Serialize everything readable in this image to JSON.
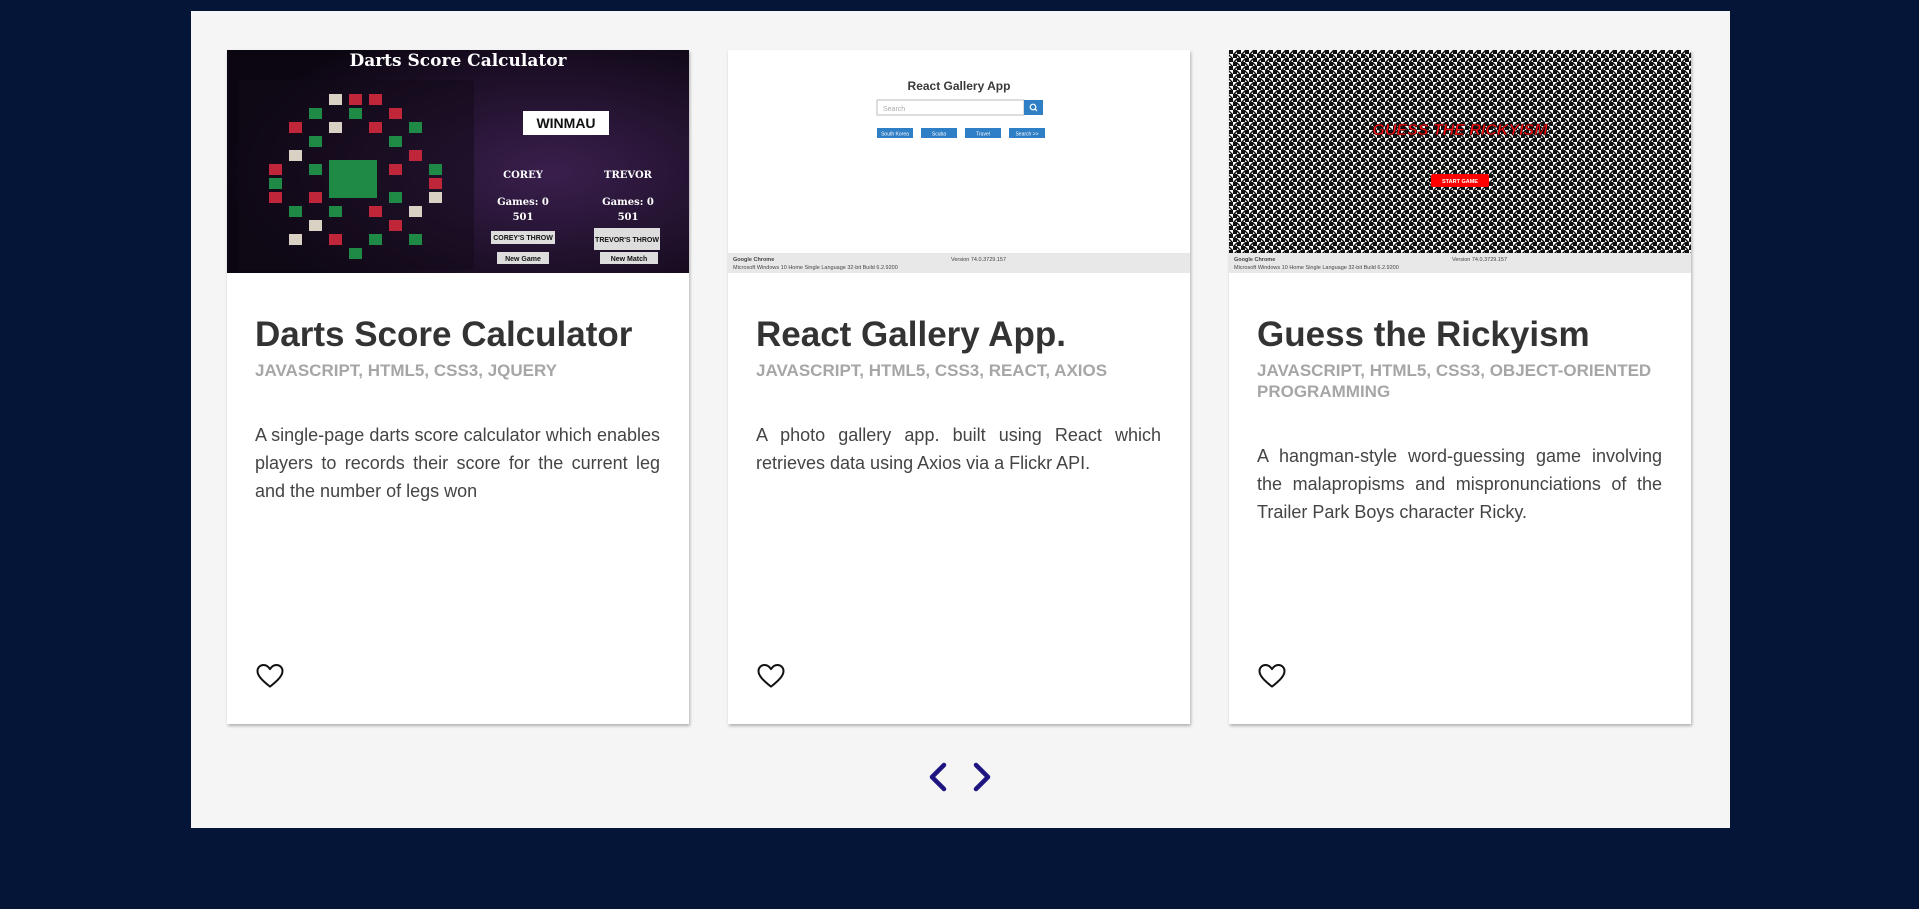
{
  "projects": [
    {
      "title": "Darts Score Calculator",
      "tags": "JAVASCRIPT, HTML5, CSS3, JQUERY",
      "description": "A single-page darts score calculator which enables players to records their score for the current leg and the number of legs won",
      "screenshot": {
        "heading": "Darts Score Calculator",
        "brand": "WINMAU",
        "player1": "COREY",
        "player2": "TREVOR",
        "games1": "Games: 0",
        "games2": "Games: 0",
        "score1": "501",
        "score2": "501",
        "throw1": "COREY'S THROW",
        "throw2": "TREVOR'S THROW",
        "new_game": "New Game",
        "new_match": "New Match"
      }
    },
    {
      "title": "React Gallery App.",
      "tags": "JAVASCRIPT, HTML5, CSS3, REACT, AXIOS",
      "description": "A photo gallery app. built using React which retrieves data using Axios via a Flickr API.",
      "screenshot": {
        "heading": "React Gallery App",
        "search_placeholder": "Search",
        "buttons": [
          "South Korea",
          "Scuba",
          "Travel",
          "Search >>"
        ],
        "footer_left": "Google Chrome",
        "footer_right": "Version 74.0.3729.157",
        "footer_os": "Microsoft Windows 10 Home Single Language 32-bit Build 6.2.9200"
      }
    },
    {
      "title": "Guess the Rickyism",
      "tags": "JAVASCRIPT, HTML5, CSS3, OBJECT-ORIENTED PROGRAMMING",
      "description": "A hangman-style word-guessing game involving the malapropisms and mispronunciations of the Trailer Park Boys character Ricky.",
      "screenshot": {
        "heading": "GUESS THE RICKYISM",
        "start_button": "START GAME",
        "footer_left": "Google Chrome",
        "footer_right": "Version 74.0.3729.157",
        "footer_os": "Microsoft Windows 10 Home Single Language 32-bit Build 6.2.9200"
      }
    }
  ],
  "icons": {
    "like": "heart-outline-icon",
    "prev": "chevron-left-icon",
    "next": "chevron-right-icon"
  },
  "colors": {
    "background": "#041538",
    "panel": "#f5f5f5",
    "title": "#333333",
    "tags": "#a6a6a6",
    "nav": "#1f1580"
  }
}
